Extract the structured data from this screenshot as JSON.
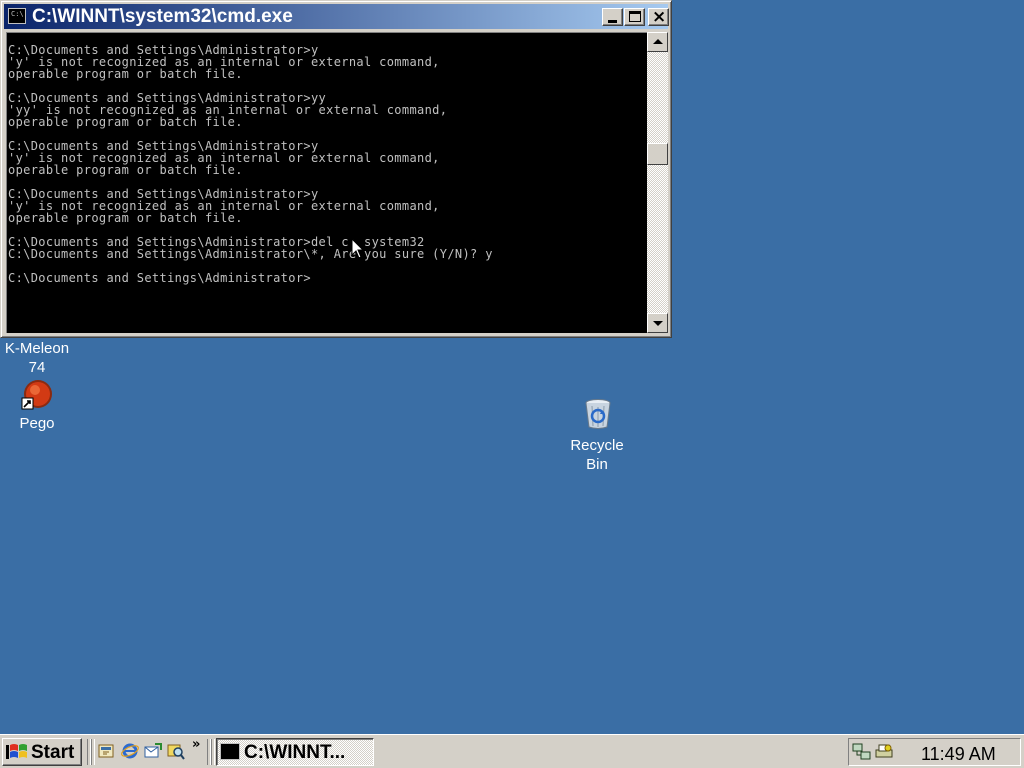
{
  "window": {
    "title": "C:\\WINNT\\system32\\cmd.exe",
    "icon": "cmd-icon"
  },
  "console": {
    "lines": [
      "C:\\Documents and Settings\\Administrator>y",
      "'y' is not recognized as an internal or external command,",
      "operable program or batch file.",
      "",
      "C:\\Documents and Settings\\Administrator>yy",
      "'yy' is not recognized as an internal or external command,",
      "operable program or batch file.",
      "",
      "C:\\Documents and Settings\\Administrator>y",
      "'y' is not recognized as an internal or external command,",
      "operable program or batch file.",
      "",
      "C:\\Documents and Settings\\Administrator>y",
      "'y' is not recognized as an internal or external command,",
      "operable program or batch file.",
      "",
      "C:\\Documents and Settings\\Administrator>del c: system32",
      "C:\\Documents and Settings\\Administrator\\*, Are you sure (Y/N)? y",
      "",
      "C:\\Documents and Settings\\Administrator>"
    ]
  },
  "desktop": {
    "kmeleon_label": "K-Meleon\n74",
    "pego_label": "Pego",
    "recycle_label": "Recycle\nBin"
  },
  "taskbar": {
    "start_label": "Start",
    "quick_launch_more": "»",
    "task_cmd_label": "C:\\WINNT...",
    "clock": "11:49 AM"
  },
  "colors": {
    "desktop": "#3a6ea5",
    "titlebar_start": "#0a246a",
    "titlebar_end": "#a6caf0",
    "console_bg": "#000000",
    "console_fg": "#c0c0c0",
    "chrome": "#d4d0c8"
  }
}
